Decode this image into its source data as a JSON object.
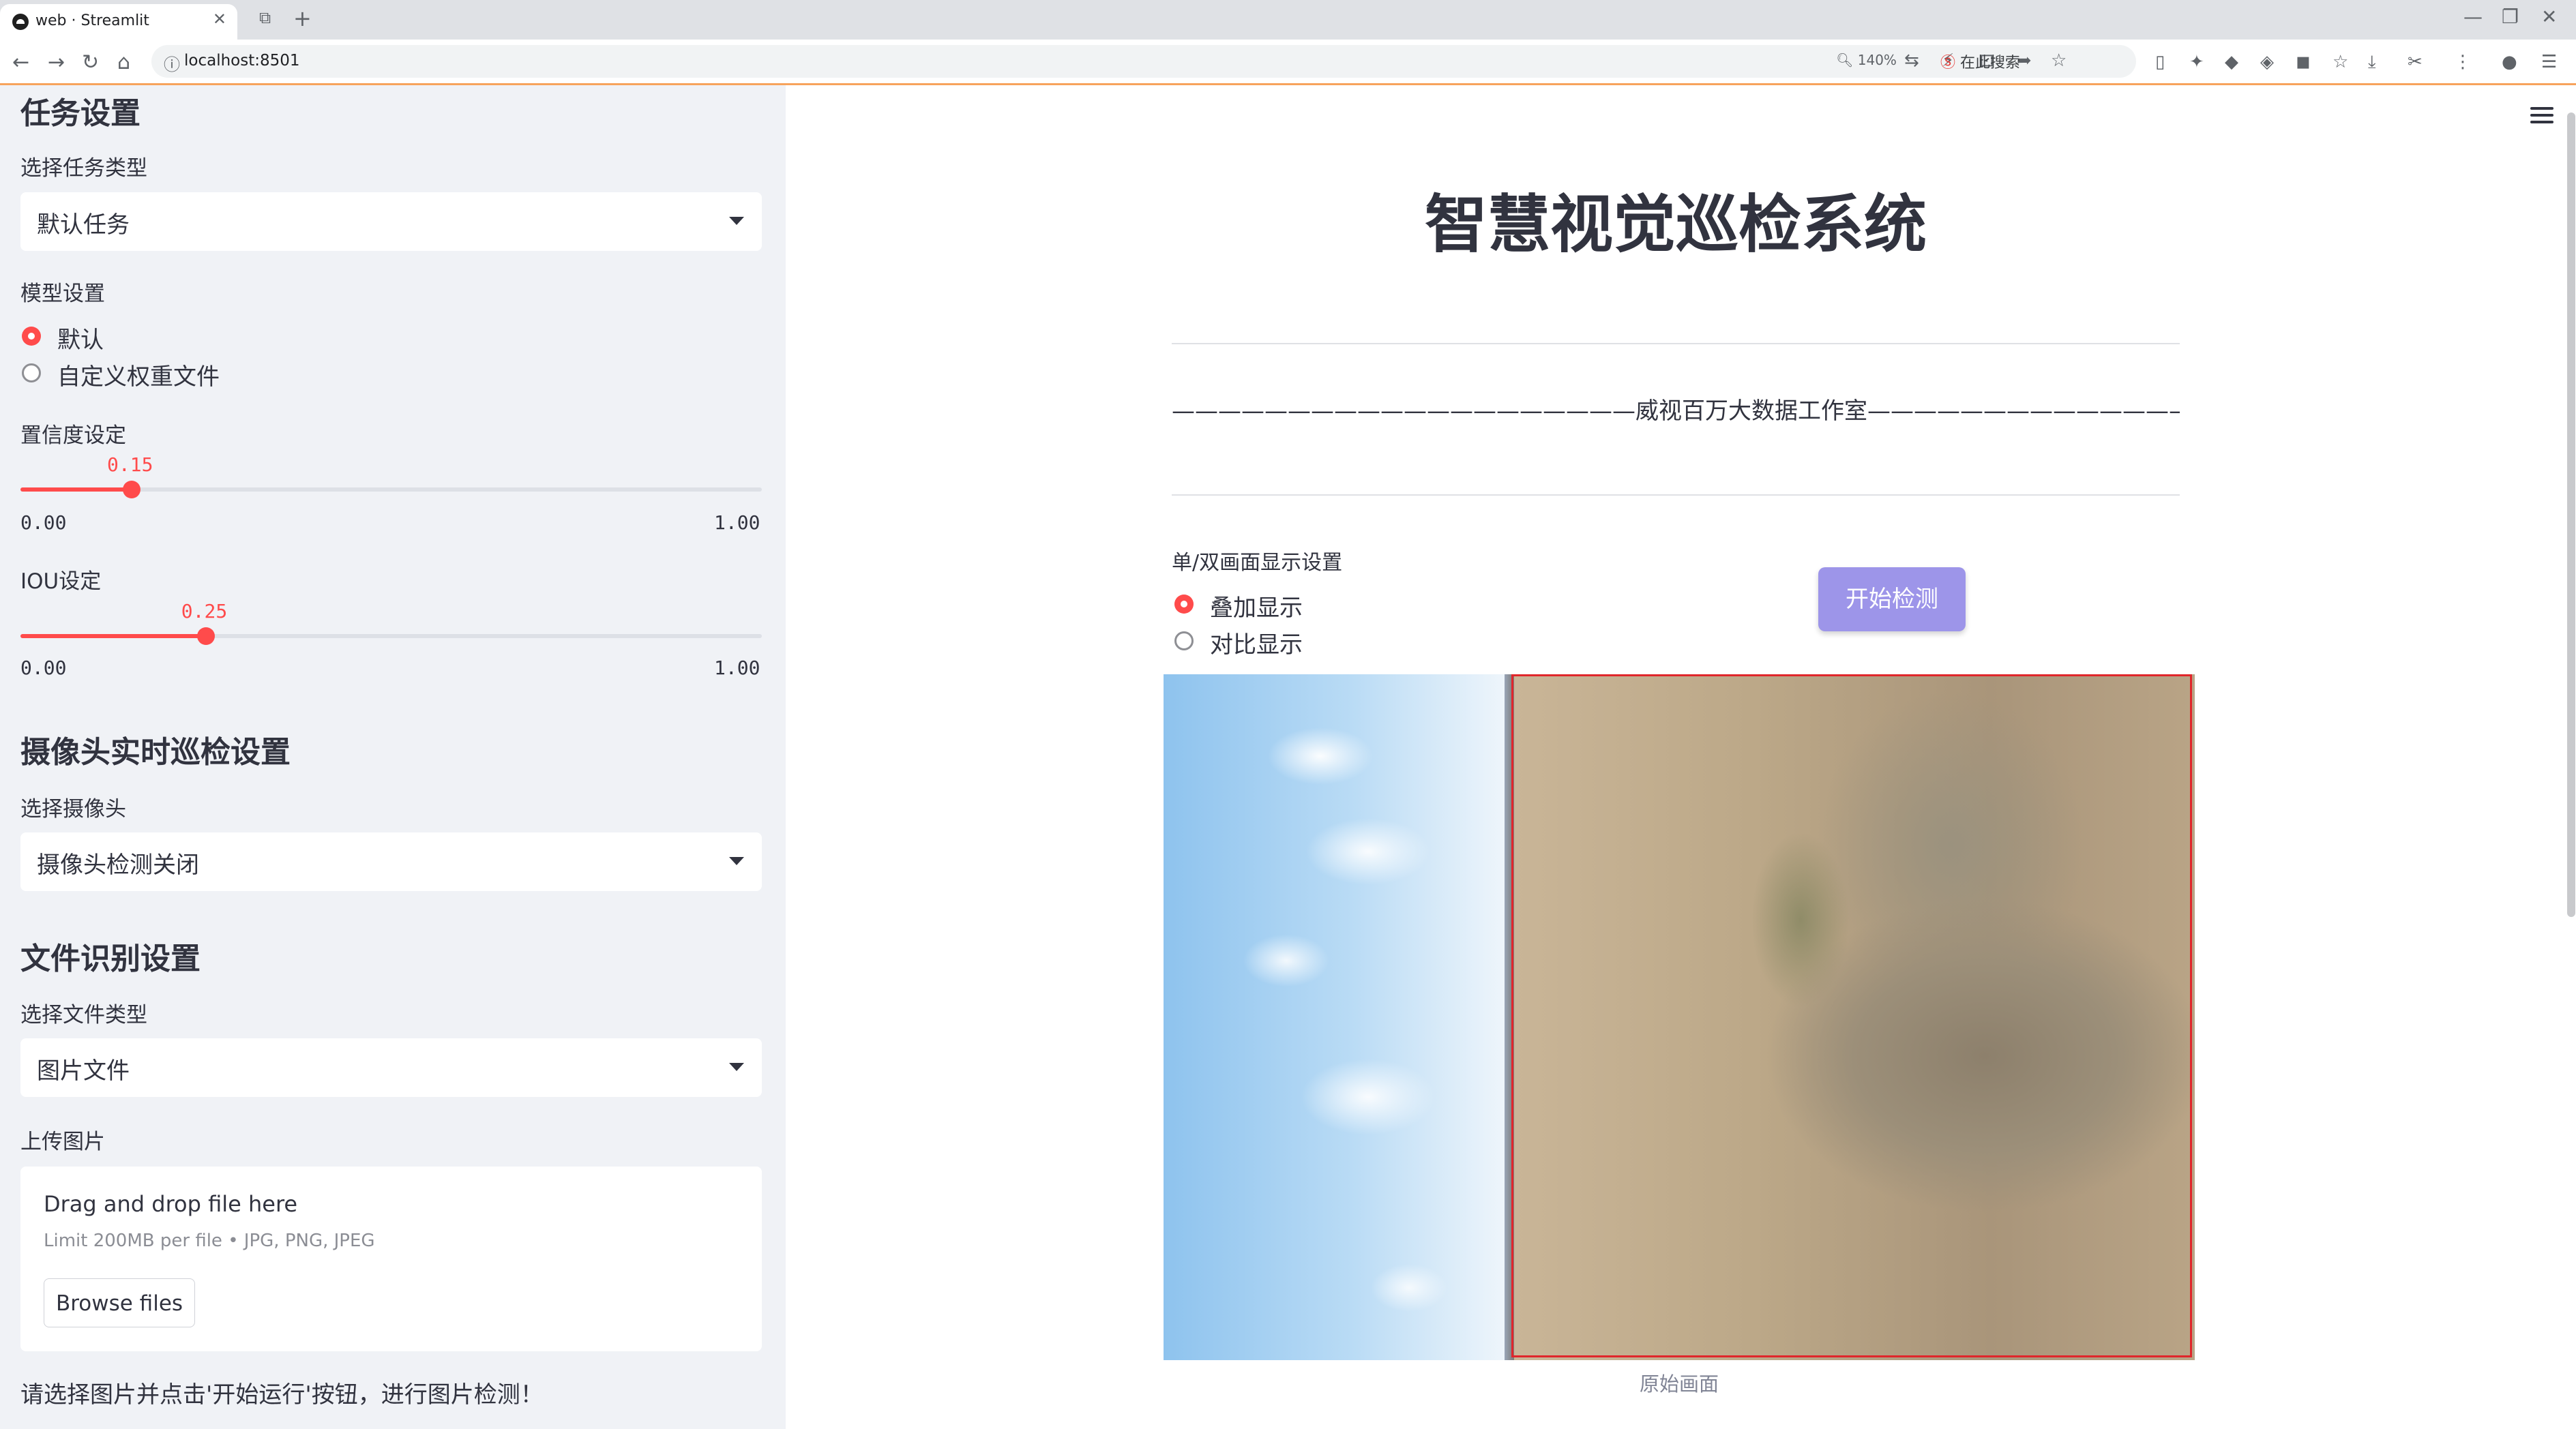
{
  "browser": {
    "tab_title": "web · Streamlit",
    "url": "localhost:8501",
    "zoom": "140%",
    "search_placeholder": "在此搜索"
  },
  "sidebar": {
    "task_section_title": "任务设置",
    "task_type_label": "选择任务类型",
    "task_type_value": "默认任务",
    "model_label": "模型设置",
    "model_options": [
      "默认",
      "自定义权重文件"
    ],
    "model_selected": "默认",
    "confidence_label": "置信度设定",
    "confidence": {
      "value": 0.15,
      "display": "0.15",
      "min": "0.00",
      "max": "1.00"
    },
    "iou_label": "IOU设定",
    "iou": {
      "value": 0.25,
      "display": "0.25",
      "min": "0.00",
      "max": "1.00"
    },
    "camera_section_title": "摄像头实时巡检设置",
    "camera_label": "选择摄像头",
    "camera_value": "摄像头检测关闭",
    "file_section_title": "文件识别设置",
    "file_type_label": "选择文件类型",
    "file_type_value": "图片文件",
    "upload_label": "上传图片",
    "upload": {
      "title": "Drag and drop file here",
      "limit": "Limit 200MB per file • JPG, PNG, JPEG",
      "button": "Browse files"
    },
    "hint": "请选择图片并点击'开始运行'按钮，进行图片检测！"
  },
  "main": {
    "title": "智慧视觉巡检系统",
    "studio_line": "————————————————————威视百万大数据工作室——————————————————————",
    "display_label": "单/双画面显示设置",
    "display_options": [
      "叠加显示",
      "对比显示"
    ],
    "display_selected": "叠加显示",
    "start_button": "开始检测",
    "image_caption": "原始画面"
  },
  "colors": {
    "accent": "#ff4b4b",
    "start_button": "#9d95e9",
    "sidebar_bg": "#f0f2f6",
    "detection_box": "#e0262b"
  },
  "icons": [
    "streamlit-favicon",
    "close-icon",
    "new-tab-icon",
    "back-icon",
    "forward-icon",
    "reload-icon",
    "home-icon",
    "site-info-icon",
    "zoom-icon",
    "star-icon",
    "download-icon",
    "menu-icon",
    "hamburger-menu-icon",
    "select-caret-icon"
  ]
}
